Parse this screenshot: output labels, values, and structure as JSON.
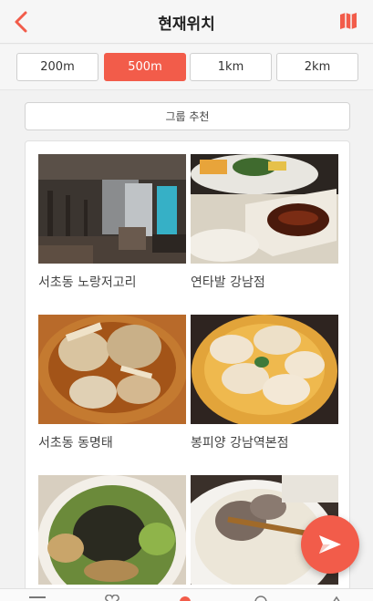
{
  "header": {
    "title": "현재위치",
    "back_icon": "chevron-left-icon",
    "map_icon": "map-icon",
    "accent": "#f25c4a"
  },
  "distance_filter": {
    "options": [
      {
        "label": "200m",
        "selected": false
      },
      {
        "label": "500m",
        "selected": true
      },
      {
        "label": "1km",
        "selected": false
      },
      {
        "label": "2km",
        "selected": false
      }
    ]
  },
  "group_button": {
    "label": "그룹 추천"
  },
  "restaurants": [
    {
      "name": "서초동 노랑저고리"
    },
    {
      "name": "연타발 강남점"
    },
    {
      "name": "서초동 동명태"
    },
    {
      "name": "봉피양 강남역본점"
    },
    {
      "name": ""
    },
    {
      "name": ""
    }
  ],
  "fab": {
    "icon": "send-icon"
  },
  "tabbar": {
    "icons": [
      "list-icon",
      "heart-icon",
      "location-icon",
      "profile-icon",
      "more-icon"
    ]
  }
}
